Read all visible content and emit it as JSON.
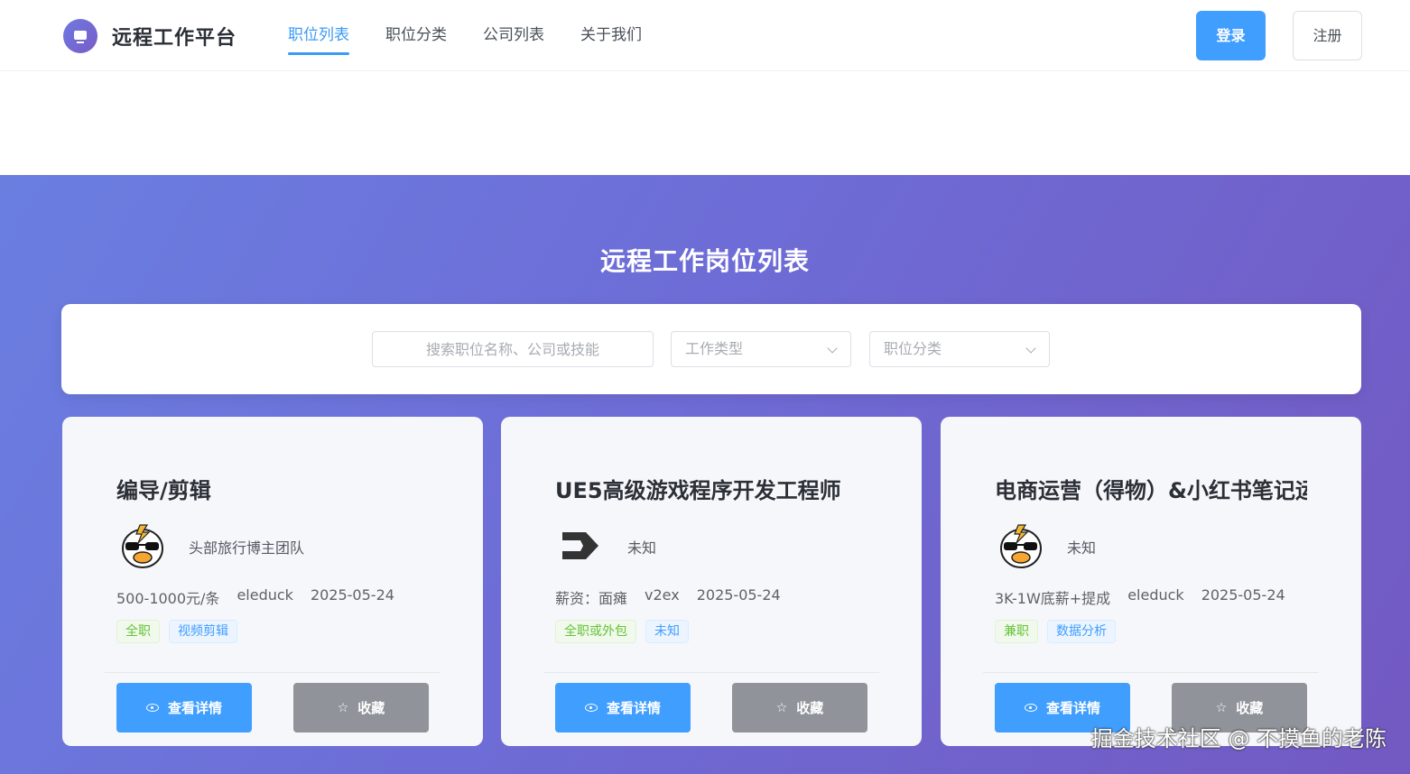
{
  "header": {
    "brand": "远程工作平台",
    "nav": [
      {
        "label": "职位列表",
        "active": true
      },
      {
        "label": "职位分类",
        "active": false
      },
      {
        "label": "公司列表",
        "active": false
      },
      {
        "label": "关于我们",
        "active": false
      }
    ],
    "login_label": "登录",
    "register_label": "注册",
    "logo_icon": "laptop-icon"
  },
  "hero": {
    "title": "远程工作岗位列表",
    "search_placeholder": "搜索职位名称、公司或技能",
    "type_placeholder": "工作类型",
    "category_placeholder": "职位分类"
  },
  "jobs": [
    {
      "title": "编导/剪辑",
      "company": "头部旅行博主团队",
      "logo": "duck-logo",
      "salary": "500-1000元/条",
      "source": "eleduck",
      "date": "2025-05-24",
      "tags": [
        {
          "text": "全职",
          "color": "green"
        },
        {
          "text": "视频剪辑",
          "color": "blue"
        }
      ],
      "detail_label": "查看详情",
      "fav_label": "收藏"
    },
    {
      "title": "UE5高级游戏程序开发工程师",
      "company": "未知",
      "logo": "v2ex-logo",
      "salary": "薪资：面瘫",
      "source": "v2ex",
      "date": "2025-05-24",
      "tags": [
        {
          "text": "全职或外包",
          "color": "green"
        },
        {
          "text": "未知",
          "color": "blue"
        }
      ],
      "detail_label": "查看详情",
      "fav_label": "收藏"
    },
    {
      "title": "电商运营（得物）&小红书笔记运营",
      "company": "未知",
      "logo": "duck-logo",
      "salary": "3K-1W底薪+提成",
      "source": "eleduck",
      "date": "2025-05-24",
      "tags": [
        {
          "text": "兼职",
          "color": "green"
        },
        {
          "text": "数据分析",
          "color": "blue"
        }
      ],
      "detail_label": "查看详情",
      "fav_label": "收藏"
    }
  ],
  "watermark": "掘金技术社区 @ 不摸鱼的老陈",
  "colors": {
    "primary": "#409eff",
    "hero_start": "#6a7ee0",
    "hero_end": "#7359c2",
    "fav_gray": "#909399"
  }
}
